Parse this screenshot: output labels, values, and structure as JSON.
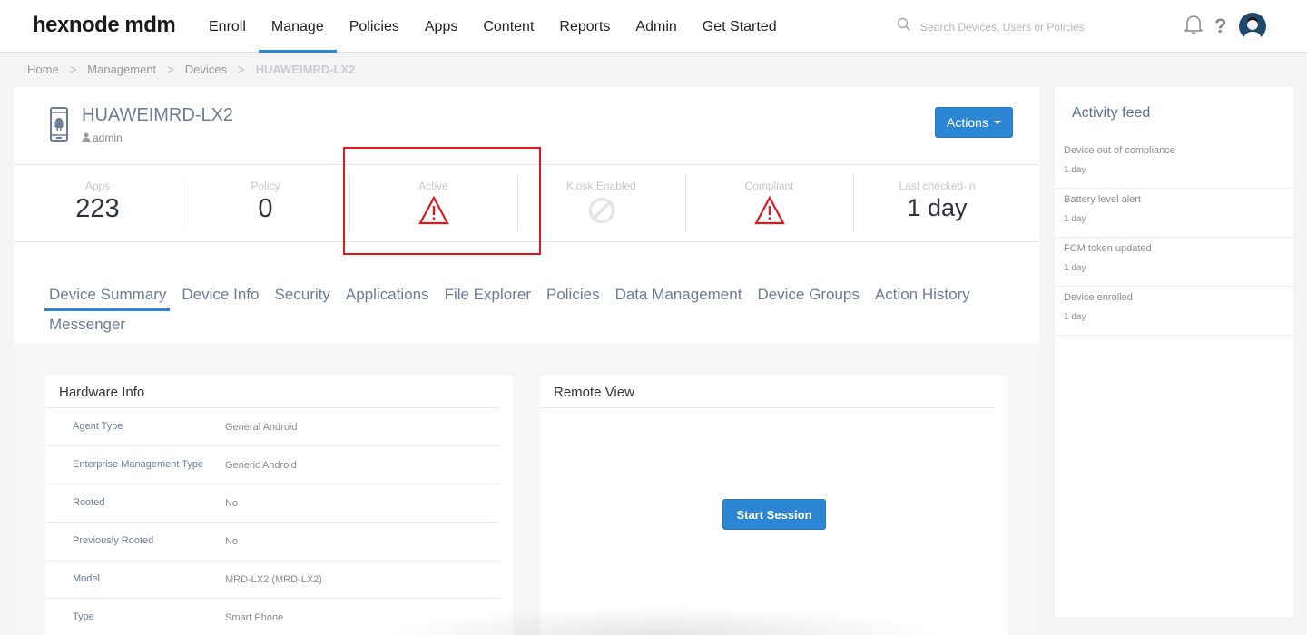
{
  "app": {
    "logo": "hexnode mdm"
  },
  "nav": {
    "items": [
      "Enroll",
      "Manage",
      "Policies",
      "Apps",
      "Content",
      "Reports",
      "Admin",
      "Get Started"
    ],
    "active": "Manage"
  },
  "search": {
    "placeholder": "Search Devices, Users or Policies"
  },
  "header_icons": {
    "notifications": "bell-icon",
    "help": "?",
    "avatar": "user-avatar"
  },
  "breadcrumb": {
    "items": [
      "Home",
      "Management",
      "Devices",
      "HUAWEIMRD-LX2"
    ],
    "separator": ">"
  },
  "device": {
    "name": "HUAWEIMRD-LX2",
    "owner": "admin",
    "platform_icon": "android-phone-icon",
    "actions_label": "Actions"
  },
  "stats": [
    {
      "label": "Apps",
      "value": "223",
      "icon": null
    },
    {
      "label": "Policy",
      "value": "0",
      "icon": null
    },
    {
      "label": "Active",
      "value": null,
      "icon": "warning-icon"
    },
    {
      "label": "Kiosk Enabled",
      "value": null,
      "icon": "disabled-icon"
    },
    {
      "label": "Compliant",
      "value": null,
      "icon": "warning-icon"
    },
    {
      "label": "Last checked-in",
      "value": "1 day",
      "icon": null
    }
  ],
  "tabs": {
    "items": [
      "Device Summary",
      "Device Info",
      "Security",
      "Applications",
      "File Explorer",
      "Policies",
      "Data Management",
      "Device Groups",
      "Action History",
      "Messenger"
    ],
    "active": "Device Summary"
  },
  "hardware_info": {
    "title": "Hardware Info",
    "rows": [
      {
        "key": "Agent Type",
        "value": "General Android"
      },
      {
        "key": "Enterprise Management Type",
        "value": "Generic Android"
      },
      {
        "key": "Rooted",
        "value": "No"
      },
      {
        "key": "Previously Rooted",
        "value": "No"
      },
      {
        "key": "Model",
        "value": "MRD-LX2 (MRD-LX2)"
      },
      {
        "key": "Type",
        "value": "Smart Phone"
      }
    ]
  },
  "remote_view": {
    "title": "Remote View",
    "start_label": "Start Session"
  },
  "activity_feed": {
    "title": "Activity feed",
    "items": [
      {
        "title": "Device out of compliance",
        "time": "1 day"
      },
      {
        "title": "Battery level alert",
        "time": "1 day"
      },
      {
        "title": "FCM token updated",
        "time": "1 day"
      },
      {
        "title": "Device enrolled",
        "time": "1 day"
      }
    ]
  },
  "colors": {
    "accent": "#2d86d3",
    "warning": "#e1191f",
    "link_text": "#6b7c98"
  }
}
